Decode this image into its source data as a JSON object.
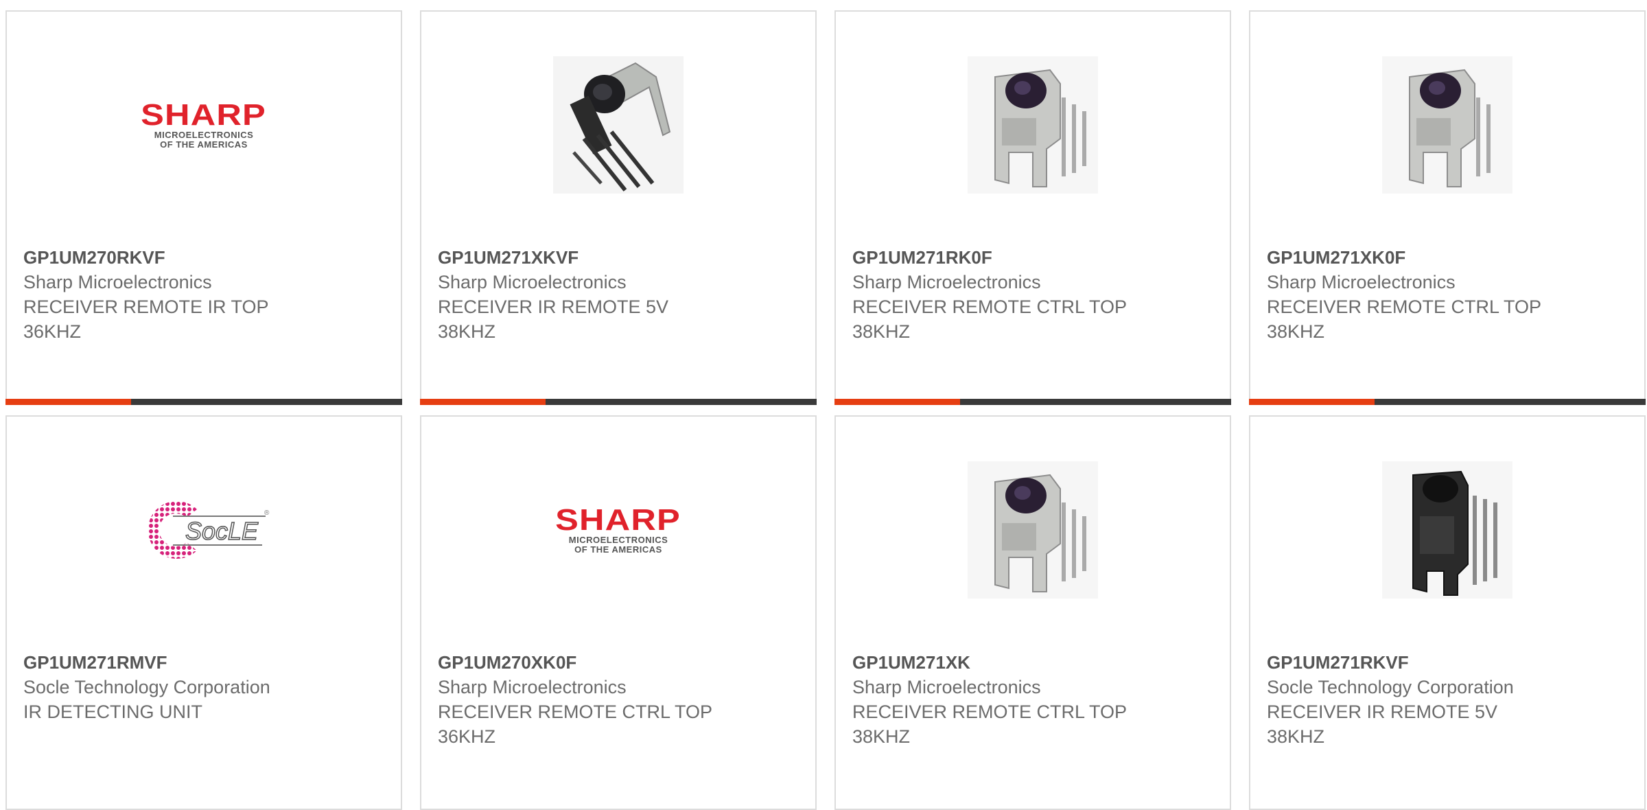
{
  "products": [
    {
      "part": "GP1UM270RKVF",
      "manufacturer": "Sharp Microelectronics",
      "description": "RECEIVER REMOTE IR TOP\n36KHZ",
      "image": "sharp-logo"
    },
    {
      "part": "GP1UM271XKVF",
      "manufacturer": "Sharp Microelectronics",
      "description": "RECEIVER IR REMOTE 5V\n38KHZ",
      "image": "ir-receiver-photo-angled"
    },
    {
      "part": "GP1UM271RK0F",
      "manufacturer": "Sharp Microelectronics",
      "description": "RECEIVER REMOTE CTRL TOP\n38KHZ",
      "image": "ir-receiver-photo"
    },
    {
      "part": "GP1UM271XK0F",
      "manufacturer": "Sharp Microelectronics",
      "description": "RECEIVER REMOTE CTRL TOP\n38KHZ",
      "image": "ir-receiver-photo"
    },
    {
      "part": "GP1UM271RMVF",
      "manufacturer": "Socle Technology Corporation",
      "description": "IR DETECTING UNIT",
      "image": "socle-logo"
    },
    {
      "part": "GP1UM270XK0F",
      "manufacturer": "Sharp Microelectronics",
      "description": "RECEIVER REMOTE CTRL TOP\n36KHZ",
      "image": "sharp-logo"
    },
    {
      "part": "GP1UM271XK",
      "manufacturer": "Sharp Microelectronics",
      "description": "RECEIVER REMOTE CTRL TOP\n38KHZ",
      "image": "ir-receiver-photo"
    },
    {
      "part": "GP1UM271RKVF",
      "manufacturer": "Socle Technology Corporation",
      "description": "RECEIVER IR REMOTE 5V\n38KHZ",
      "image": "ir-receiver-photo-dark"
    }
  ],
  "logos": {
    "sharp_word": "SHARP",
    "sharp_sub_line1": "MICROELECTRONICS",
    "sharp_sub_line2": "OF THE AMERICAS",
    "socle_word": "SocLE"
  },
  "colors": {
    "accent": "#e63e12",
    "bar": "#3a3a3a",
    "sharp_red": "#e0222b",
    "socle_pink": "#d6217a"
  }
}
